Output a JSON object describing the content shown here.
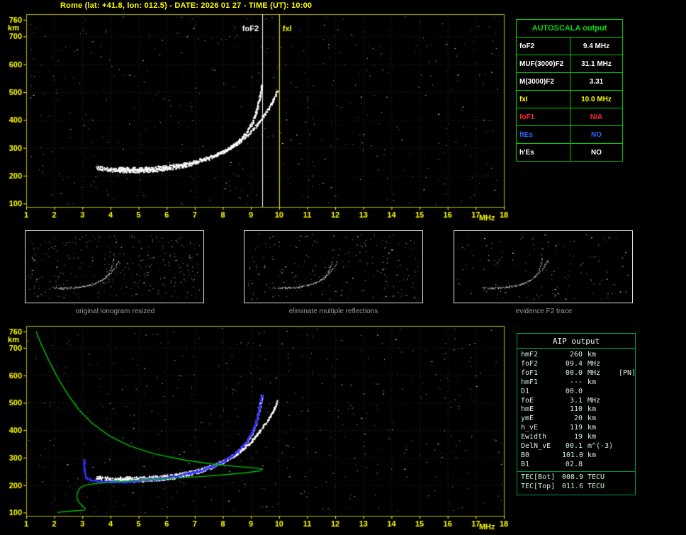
{
  "title": "Rome (lat: +41.8, lon: 012.5) - DATE: 2026 01 27 - TIME (UT): 10:00",
  "colors": {
    "axis": "#ffff00",
    "border": "#b5b500",
    "grid": "rgba(255,255,255,0.20)",
    "trace_white": "#ffffff",
    "profile_green": "#00c000",
    "restored_blue": "#2e2eff",
    "table_green": "#00cc00",
    "caption_gray": "#9a9a9a"
  },
  "autoscala_table": {
    "title": "AUTOSCALA output",
    "rows": [
      {
        "label": "foF2",
        "value": "9.4 MHz",
        "color": "#ffffff"
      },
      {
        "label": "MUF(3000)F2",
        "value": "31.1 MHz",
        "color": "#ffffff"
      },
      {
        "label": "M(3000)F2",
        "value": "3.31",
        "color": "#ffffff"
      },
      {
        "label": "fxI",
        "value": "10.0 MHz",
        "color": "#ffff00"
      },
      {
        "label": "foF1",
        "value": "N/A",
        "color": "#ff2a2a"
      },
      {
        "label": "ftEs",
        "value": "NO",
        "color": "#2f62ff"
      },
      {
        "label": "h'Es",
        "value": "NO",
        "color": "#ffffff"
      }
    ]
  },
  "thumbnails": [
    {
      "caption": "original ionogram resized",
      "noise": 320,
      "seed": 101
    },
    {
      "caption": "eliminate multiple reflections",
      "noise": 220,
      "seed": 202
    },
    {
      "caption": "evidence F2 trace",
      "noise": 150,
      "seed": 303
    }
  ],
  "aip_table": {
    "title": "AIP output",
    "rows": [
      {
        "label": "hmF2",
        "value": "260",
        "unit": "km",
        "note": ""
      },
      {
        "label": "foF2",
        "value": "09.4",
        "unit": "MHz",
        "note": ""
      },
      {
        "label": "foF1",
        "value": "00.0",
        "unit": "MHz",
        "note": "[PN]"
      },
      {
        "label": "hmF1",
        "value": "---",
        "unit": "km",
        "note": ""
      },
      {
        "label": "D1",
        "value": "00.0",
        "unit": "",
        "note": ""
      },
      {
        "label": "foE",
        "value": "3.1",
        "unit": "MHz",
        "note": ""
      },
      {
        "label": "hmE",
        "value": "110",
        "unit": "km",
        "note": ""
      },
      {
        "label": "ymE",
        "value": "20",
        "unit": "km",
        "note": ""
      },
      {
        "label": "h_vE",
        "value": "119",
        "unit": "km",
        "note": ""
      },
      {
        "label": "Ewidth",
        "value": "19",
        "unit": "km",
        "note": ""
      },
      {
        "label": "DelN_vE",
        "value": "00.1",
        "unit": "m^(-3)",
        "note": ""
      },
      {
        "label": "B0",
        "value": "101.0",
        "unit": "km",
        "note": ""
      },
      {
        "label": "B1",
        "value": "02.8",
        "unit": "",
        "note": ""
      },
      {
        "label": "TEC[Bot]",
        "value": "008.9",
        "unit": "TECU",
        "note": "",
        "separator": true
      },
      {
        "label": "TEC[Top]",
        "value": "011.6",
        "unit": "TECU",
        "note": ""
      }
    ]
  },
  "chart_data": [
    {
      "type": "scatter",
      "name": "ionogram with autoscaled characteristics",
      "xlabel": "MHz",
      "ylabel": "km",
      "xlim": [
        1,
        18
      ],
      "ylim": [
        100,
        760
      ],
      "x_ticks": [
        1,
        2,
        3,
        4,
        5,
        6,
        7,
        8,
        9,
        10,
        11,
        12,
        13,
        14,
        15,
        16,
        17,
        18
      ],
      "y_ticks": [
        100,
        200,
        300,
        400,
        500,
        600,
        700,
        760
      ],
      "grid": true,
      "markers": [
        {
          "label": "foF2",
          "f": 9.4,
          "color": "#ffffff",
          "side": "left"
        },
        {
          "label": "fxI",
          "f": 10.0,
          "color": "#ffff00",
          "side": "right"
        }
      ],
      "traces": [
        {
          "name": "O-mode echo trace",
          "points": [
            [
              3.5,
              230
            ],
            [
              4,
              223
            ],
            [
              4.5,
              220
            ],
            [
              5,
              220
            ],
            [
              5.5,
              222
            ],
            [
              6,
              227
            ],
            [
              6.5,
              235
            ],
            [
              7,
              247
            ],
            [
              7.5,
              263
            ],
            [
              8,
              286
            ],
            [
              8.4,
              313
            ],
            [
              8.8,
              353
            ],
            [
              9.05,
              395
            ],
            [
              9.2,
              440
            ],
            [
              9.3,
              485
            ],
            [
              9.38,
              530
            ]
          ],
          "th0": 6,
          "th1": 3,
          "p": 0.8
        },
        {
          "name": "X-mode echo trace",
          "points": [
            [
              4.3,
              226
            ],
            [
              5,
              226
            ],
            [
              5.5,
              229
            ],
            [
              6,
              234
            ],
            [
              6.5,
              242
            ],
            [
              7,
              253
            ],
            [
              7.5,
              268
            ],
            [
              8,
              288
            ],
            [
              8.5,
              315
            ],
            [
              8.9,
              350
            ],
            [
              9.3,
              397
            ],
            [
              9.6,
              440
            ],
            [
              9.8,
              478
            ],
            [
              9.93,
              510
            ]
          ],
          "th0": 5,
          "th1": 3,
          "p": 0.8
        }
      ]
    },
    {
      "type": "scatter",
      "name": "ionogram with restored trace and electron density profile",
      "xlabel": "MHz",
      "ylabel": "km",
      "xlim": [
        1,
        18
      ],
      "ylim": [
        100,
        760
      ],
      "x_ticks": [
        1,
        2,
        3,
        4,
        5,
        6,
        7,
        8,
        9,
        10,
        11,
        12,
        13,
        14,
        15,
        16,
        17,
        18
      ],
      "y_ticks": [
        100,
        200,
        300,
        400,
        500,
        600,
        700,
        760
      ],
      "grid": true,
      "traces": [
        {
          "name": "O-mode echo trace",
          "points": [
            [
              3.5,
              230
            ],
            [
              4,
              223
            ],
            [
              4.5,
              220
            ],
            [
              5,
              220
            ],
            [
              5.5,
              222
            ],
            [
              6,
              227
            ],
            [
              6.5,
              235
            ],
            [
              7,
              247
            ],
            [
              7.5,
              263
            ],
            [
              8,
              286
            ],
            [
              8.4,
              313
            ],
            [
              8.8,
              353
            ],
            [
              9.05,
              395
            ],
            [
              9.2,
              440
            ],
            [
              9.3,
              485
            ],
            [
              9.38,
              530
            ]
          ],
          "th0": 6,
          "th1": 3,
          "p": 0.8
        },
        {
          "name": "X-mode echo trace",
          "points": [
            [
              4.3,
              226
            ],
            [
              5,
              226
            ],
            [
              5.5,
              229
            ],
            [
              6,
              234
            ],
            [
              6.5,
              242
            ],
            [
              7,
              253
            ],
            [
              7.5,
              268
            ],
            [
              8,
              288
            ],
            [
              8.5,
              315
            ],
            [
              8.9,
              350
            ],
            [
              9.3,
              397
            ],
            [
              9.6,
              440
            ],
            [
              9.8,
              478
            ],
            [
              9.93,
              510
            ]
          ],
          "th0": 5,
          "th1": 3,
          "p": 0.8
        }
      ],
      "restored_trace": {
        "name": "restored O-mode trace",
        "color": "#2e2eff",
        "points": [
          [
            3.05,
            293
          ],
          [
            3.05,
            250
          ],
          [
            3.12,
            228
          ],
          [
            3.3,
            219
          ],
          [
            3.6,
            215
          ],
          [
            4,
            214
          ],
          [
            4.5,
            215
          ],
          [
            5,
            218
          ],
          [
            5.5,
            223
          ],
          [
            6,
            229
          ],
          [
            6.5,
            238
          ],
          [
            7,
            250
          ],
          [
            7.5,
            266
          ],
          [
            8,
            288
          ],
          [
            8.4,
            315
          ],
          [
            8.8,
            355
          ],
          [
            9.05,
            397
          ],
          [
            9.2,
            442
          ],
          [
            9.3,
            490
          ],
          [
            9.38,
            533
          ]
        ],
        "th0": 3,
        "th1": 3,
        "p": 0.95
      },
      "profile": {
        "name": "electron density profile (plasma frequency vs height)",
        "color": "#00c000",
        "points": [
          [
            1.35,
            760
          ],
          [
            1.55,
            710
          ],
          [
            1.8,
            655
          ],
          [
            2.1,
            595
          ],
          [
            2.45,
            535
          ],
          [
            2.85,
            478
          ],
          [
            3.35,
            425
          ],
          [
            3.95,
            380
          ],
          [
            4.7,
            342
          ],
          [
            5.6,
            313
          ],
          [
            6.6,
            292
          ],
          [
            7.6,
            277
          ],
          [
            8.6,
            267
          ],
          [
            9.2,
            262
          ],
          [
            9.4,
            258
          ],
          [
            9.3,
            252
          ],
          [
            8.9,
            246
          ],
          [
            8.2,
            239
          ],
          [
            7.2,
            231
          ],
          [
            6,
            224
          ],
          [
            4.9,
            217
          ],
          [
            4,
            211
          ],
          [
            3.4,
            205
          ],
          [
            3.05,
            198
          ],
          [
            2.9,
            188
          ],
          [
            2.82,
            172
          ],
          [
            2.8,
            155
          ],
          [
            2.86,
            140
          ],
          [
            2.96,
            128
          ],
          [
            3.06,
            119
          ],
          [
            3.1,
            112
          ],
          [
            3.08,
            109
          ],
          [
            2.7,
            106
          ],
          [
            2.3,
            103
          ],
          [
            2.1,
            100
          ]
        ]
      }
    }
  ]
}
